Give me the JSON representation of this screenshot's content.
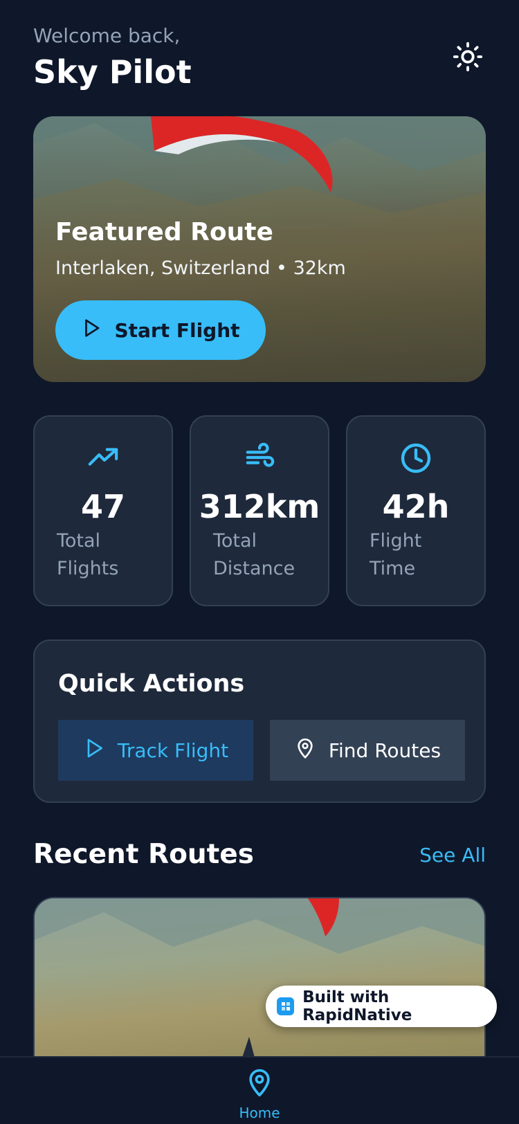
{
  "header": {
    "welcome": "Welcome back,",
    "username": "Sky Pilot",
    "theme_icon": "sun-icon"
  },
  "featured": {
    "title": "Featured Route",
    "subtitle": "Interlaken, Switzerland • 32km",
    "button_label": "Start Flight",
    "button_icon": "play-icon"
  },
  "stats": [
    {
      "icon": "trending-up-icon",
      "value": "47",
      "label": "Total Flights"
    },
    {
      "icon": "wind-icon",
      "value": "312km",
      "label": "Total Distance"
    },
    {
      "icon": "clock-icon",
      "value": "42h",
      "label": "Flight Time"
    }
  ],
  "quick_actions": {
    "title": "Quick Actions",
    "track_label": "Track Flight",
    "find_label": "Find Routes"
  },
  "recent": {
    "title": "Recent Routes",
    "see_all": "See All"
  },
  "badge": {
    "label": "Built with RapidNative"
  },
  "tabbar": {
    "home_label": "Home"
  },
  "colors": {
    "background": "#0f172a",
    "card": "#1e293b",
    "accent": "#38bdf8",
    "muted": "#94a3b8"
  }
}
